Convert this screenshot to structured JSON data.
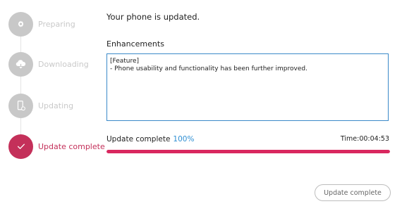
{
  "colors": {
    "accent": "#c4305a",
    "progress_fill": "#d9285f",
    "percent_text": "#2f8fd3",
    "inactive_step": "#c8c8c8",
    "notes_border": "#3b89c9"
  },
  "steps": [
    {
      "label": "Preparing",
      "icon": "gear-icon",
      "state": "inactive"
    },
    {
      "label": "Downloading",
      "icon": "cloud-download-icon",
      "state": "inactive"
    },
    {
      "label": "Updating",
      "icon": "phone-update-icon",
      "state": "inactive"
    },
    {
      "label": "Update complete",
      "icon": "checkmark-icon",
      "state": "active"
    }
  ],
  "main": {
    "status_message": "Your phone is updated.",
    "enhancements_heading": "Enhancements",
    "notes_lines": [
      "[Feature]",
      "- Phone usability and functionality has been further improved."
    ]
  },
  "progress": {
    "label": "Update complete",
    "percent_text": "100%",
    "percent_value": 100,
    "time_text": "Time:00:04:53"
  },
  "footer": {
    "button_label": "Update complete"
  }
}
